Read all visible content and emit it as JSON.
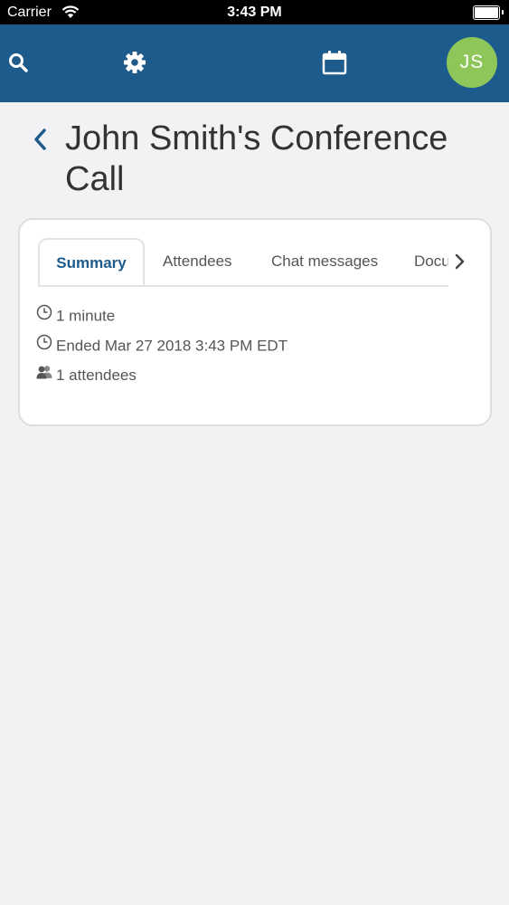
{
  "status_bar": {
    "carrier": "Carrier",
    "time": "3:43 PM"
  },
  "header": {
    "avatar_initials": "JS",
    "icons": [
      "search-icon",
      "gear-icon",
      "calendar-icon"
    ],
    "colors": {
      "bar": "#1d5b8c",
      "avatar": "#8fc65a"
    }
  },
  "page": {
    "title": "John Smith's Conference Call"
  },
  "tabs": [
    {
      "label": "Summary",
      "active": true
    },
    {
      "label": "Attendees",
      "active": false
    },
    {
      "label": "Chat messages",
      "active": false
    },
    {
      "label": "Docu",
      "active": false
    }
  ],
  "summary": {
    "duration": "1 minute",
    "ended": "Ended Mar 27 2018 3:43 PM EDT",
    "attendees": "1 attendees"
  }
}
